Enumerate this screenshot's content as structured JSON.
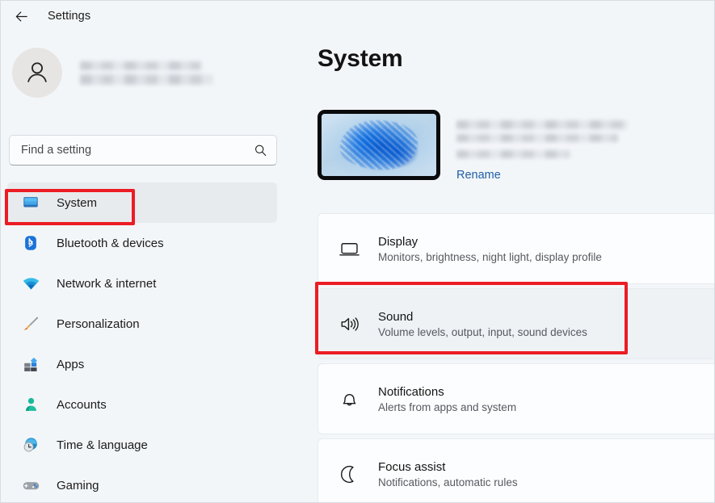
{
  "titlebar": {
    "back_icon": "back-arrow-icon",
    "title": "Settings"
  },
  "sidebar": {
    "profile": {
      "avatar_icon": "person-avatar-icon",
      "name_redacted": true,
      "account_redacted": true
    },
    "search": {
      "placeholder": "Find a setting",
      "value": "",
      "icon": "search-icon"
    },
    "items": [
      {
        "label": "System",
        "icon": "monitor-icon",
        "selected": true,
        "highlighted": true
      },
      {
        "label": "Bluetooth & devices",
        "icon": "bluetooth-icon",
        "selected": false,
        "highlighted": false
      },
      {
        "label": "Network & internet",
        "icon": "wifi-icon",
        "selected": false,
        "highlighted": false
      },
      {
        "label": "Personalization",
        "icon": "paintbrush-icon",
        "selected": false,
        "highlighted": false
      },
      {
        "label": "Apps",
        "icon": "apps-grid-icon",
        "selected": false,
        "highlighted": false
      },
      {
        "label": "Accounts",
        "icon": "person-icon",
        "selected": false,
        "highlighted": false
      },
      {
        "label": "Time & language",
        "icon": "clock-globe-icon",
        "selected": false,
        "highlighted": false
      },
      {
        "label": "Gaming",
        "icon": "gamepad-icon",
        "selected": false,
        "highlighted": false
      }
    ]
  },
  "main": {
    "page_title": "System",
    "device": {
      "thumbnail_icon": "windows-bloom-wallpaper-thumbnail",
      "name_redacted": true,
      "model_redacted": true,
      "rename_label": "Rename"
    },
    "cards": [
      {
        "title": "Display",
        "subtitle": "Monitors, brightness, night light, display profile",
        "icon": "display-monitor-icon",
        "hovered": false,
        "highlighted": false
      },
      {
        "title": "Sound",
        "subtitle": "Volume levels, output, input, sound devices",
        "icon": "speaker-volume-icon",
        "hovered": true,
        "highlighted": true
      },
      {
        "title": "Notifications",
        "subtitle": "Alerts from apps and system",
        "icon": "bell-icon",
        "hovered": false,
        "highlighted": false
      },
      {
        "title": "Focus assist",
        "subtitle": "Notifications, automatic rules",
        "icon": "crescent-moon-icon",
        "hovered": false,
        "highlighted": false
      }
    ]
  },
  "annotations": {
    "color": "#EC1C24",
    "boxes": [
      {
        "target": "sidebar-item-system",
        "name": "annotation-box-system"
      },
      {
        "target": "settings-card-sound",
        "name": "annotation-box-sound"
      }
    ]
  },
  "colors": {
    "window_bg": "#F3F6F9",
    "card_bg": "#FCFDFE",
    "card_hover_bg": "#EEF2F5",
    "sidebar_selected_bg": "#E8EBEE",
    "link_blue": "#1F5FA8",
    "text_primary": "#141414",
    "text_secondary": "#555A60",
    "annotation_red": "#EC1C24"
  }
}
